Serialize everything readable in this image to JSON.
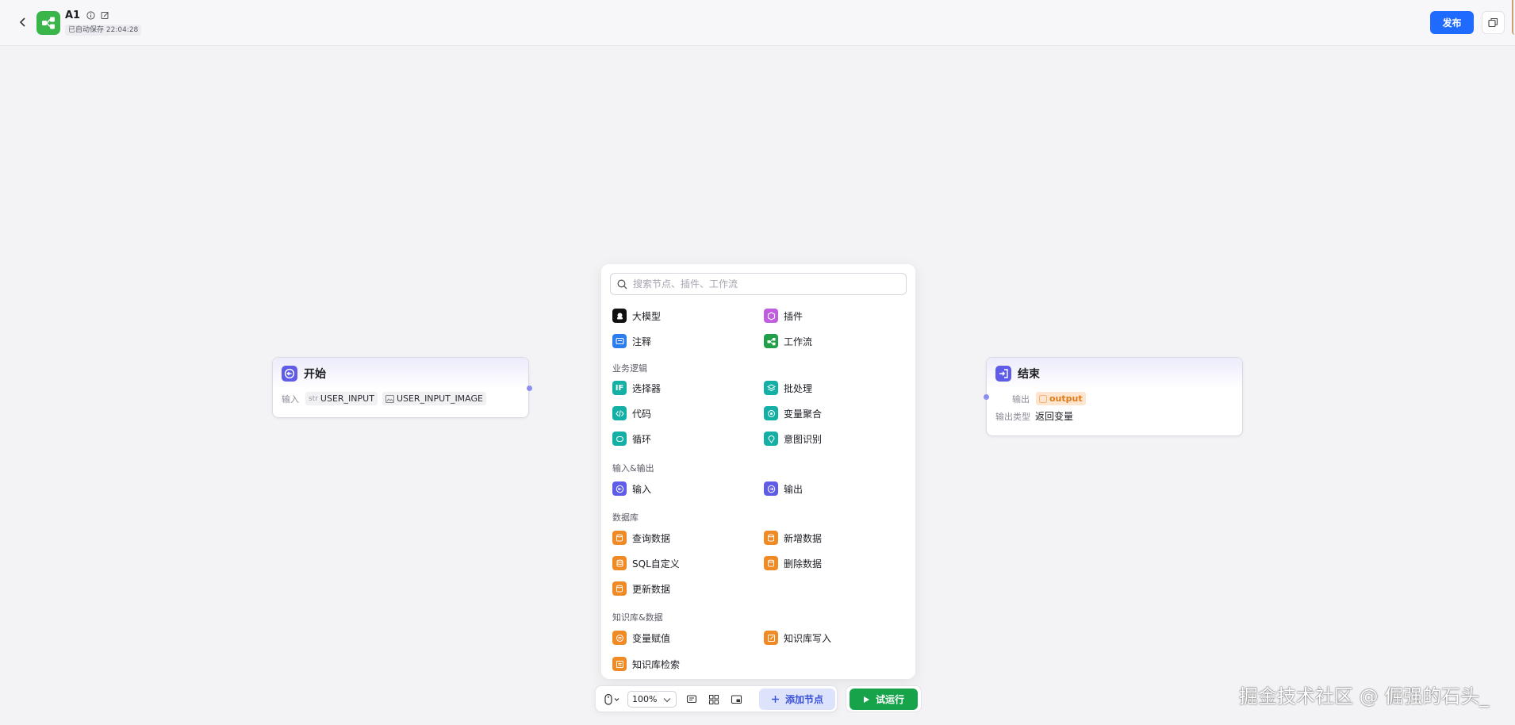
{
  "header": {
    "title": "A1",
    "autosave": "已自动保存 22:04:28",
    "publish_label": "发布"
  },
  "start_node": {
    "title": "开始",
    "input_label": "输入",
    "inputs": [
      {
        "prefix": "str",
        "name": "USER_INPUT"
      },
      {
        "name": "USER_INPUT_IMAGE"
      }
    ]
  },
  "end_node": {
    "title": "结束",
    "output_label": "输出",
    "output_var": "output",
    "output_type_label": "输出类型",
    "output_type_value": "返回变量"
  },
  "panel": {
    "search_placeholder": "搜索节点、插件、工作流",
    "top_items": [
      "大模型",
      "插件",
      "注释",
      "工作流"
    ],
    "sections": [
      {
        "label": "业务逻辑",
        "items": [
          "选择器",
          "批处理",
          "代码",
          "变量聚合",
          "循环",
          "意图识别"
        ]
      },
      {
        "label": "输入&输出",
        "items": [
          "输入",
          "输出"
        ]
      },
      {
        "label": "数据库",
        "items": [
          "查询数据",
          "新增数据",
          "SQL自定义",
          "删除数据",
          "更新数据"
        ]
      },
      {
        "label": "知识库&数据",
        "items": [
          "变量赋值",
          "知识库写入",
          "知识库检索"
        ]
      }
    ]
  },
  "toolbar": {
    "zoom": "100%",
    "add_node_label": "添加节点",
    "trial_run_label": "试运行"
  },
  "watermark": "掘金技术社区 @ 倔强的石头_",
  "colors": {
    "accent": "#1f6bff",
    "run": "#16a34a",
    "node_icon": "#5f5de8"
  }
}
